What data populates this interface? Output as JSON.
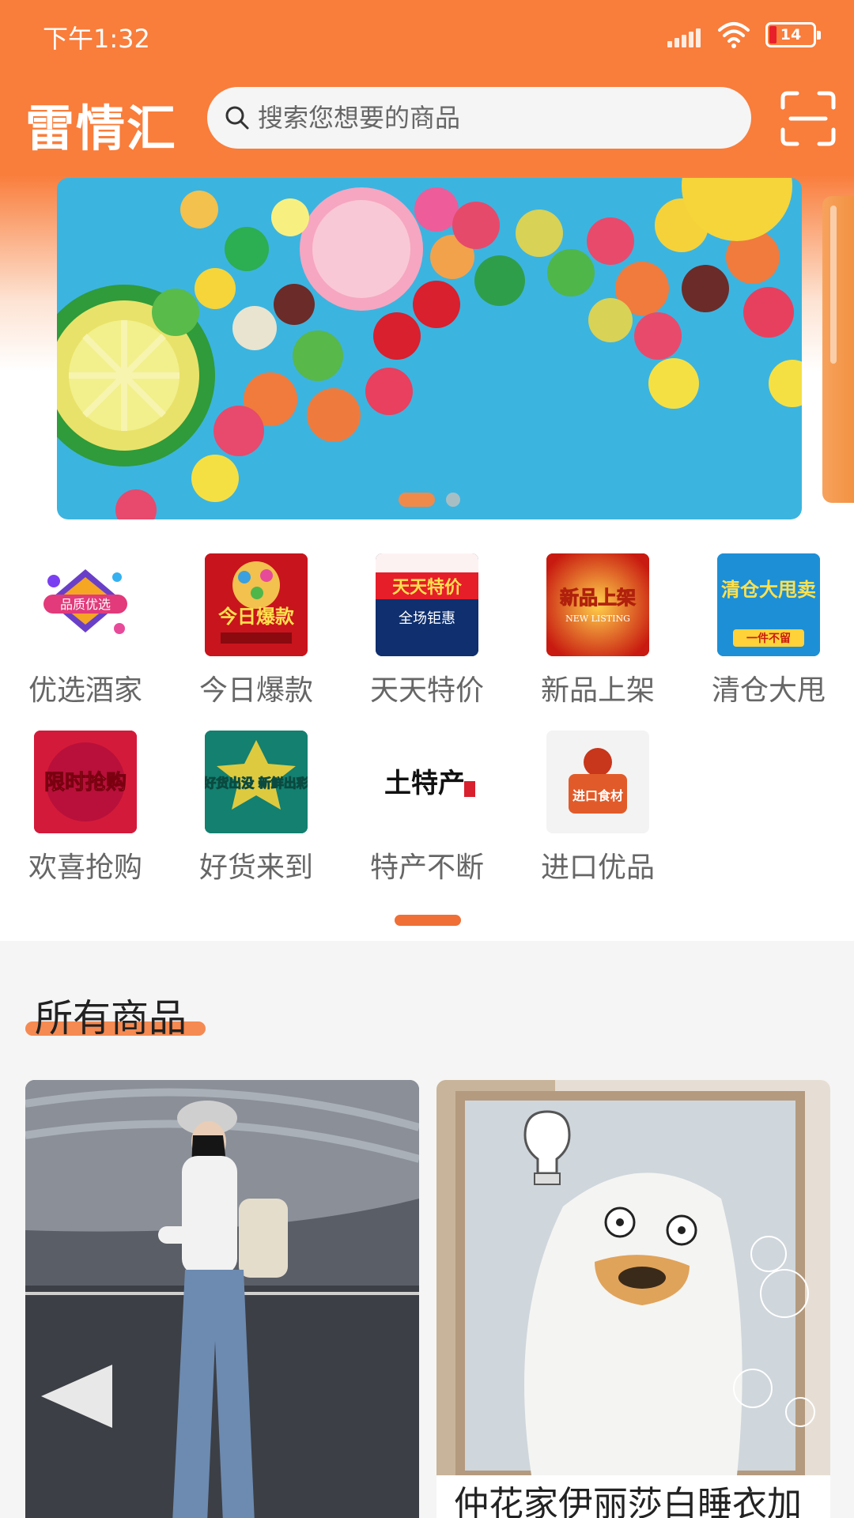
{
  "status_bar": {
    "time": "下午1:32",
    "battery": "14"
  },
  "header": {
    "logo": "雷情汇",
    "search_placeholder": "搜索您想要的商品"
  },
  "banner": {
    "slide_count": 2,
    "active_slide": 1
  },
  "categories": [
    {
      "label": "优选酒家",
      "icon_text": "品质优选"
    },
    {
      "label": "今日爆款",
      "icon_text": "今日爆款"
    },
    {
      "label": "天天特价",
      "icon_text": "天天特价",
      "icon_subtext": "全场钜惠"
    },
    {
      "label": "新品上架",
      "icon_text": "新品上架",
      "icon_subtext": "NEW LISTING"
    },
    {
      "label": "清仓大甩",
      "icon_text": "清仓大甩卖",
      "icon_subtext": "一件不留"
    },
    {
      "label": "欢喜抢购",
      "icon_text": "限时抢购"
    },
    {
      "label": "好货来到",
      "icon_text": "好货出没 新鲜出彩"
    },
    {
      "label": "特产不断",
      "icon_text": "土特产"
    },
    {
      "label": "进口优品",
      "icon_text": "进口食材"
    }
  ],
  "section": {
    "title": "所有商品"
  },
  "products": [
    {
      "title": ""
    },
    {
      "title": "仲花家伊丽莎白睡衣加"
    }
  ],
  "colors": {
    "brand": "#f97d3b",
    "accent": "#ef6f36"
  }
}
